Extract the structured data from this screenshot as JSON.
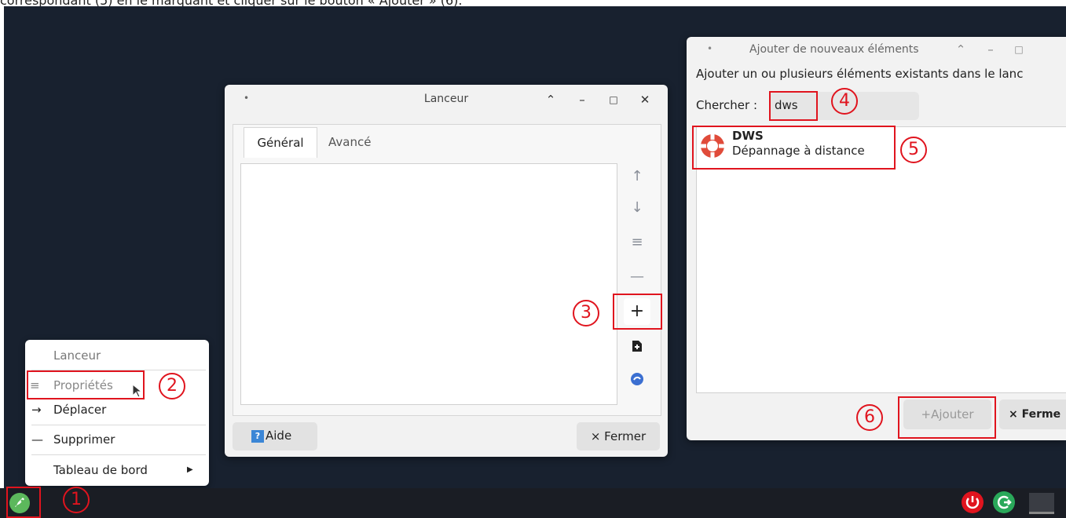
{
  "caption": "correspondant (5) en le marquant et cliquer sur le bouton « Ajouter » (6).",
  "launcher_window": {
    "title": "Lanceur",
    "tabs": [
      "Général",
      "Avancé"
    ],
    "help_label": "Aide",
    "help_icon": "?",
    "close_label": "× Fermer"
  },
  "add_window": {
    "title": "Ajouter de nouveaux éléments",
    "description": "Ajouter un ou plusieurs éléments existants dans le lanc",
    "search_label": "Chercher :",
    "search_value": "dws",
    "result": {
      "name": "DWS",
      "description": "Dépannage à distance"
    },
    "add_label": "Ajouter",
    "close_label": "× Ferme"
  },
  "context_menu": {
    "title": "Lanceur",
    "items": [
      "Propriétés",
      "Déplacer",
      "Supprimer",
      "Tableau de bord"
    ]
  },
  "annotations": [
    "1",
    "2",
    "3",
    "4",
    "5",
    "6"
  ],
  "colors": {
    "desktop": "#18212f",
    "taskbar": "#1a1d24",
    "annotation": "#e0141e",
    "launcher_green": "#5cb85c"
  }
}
